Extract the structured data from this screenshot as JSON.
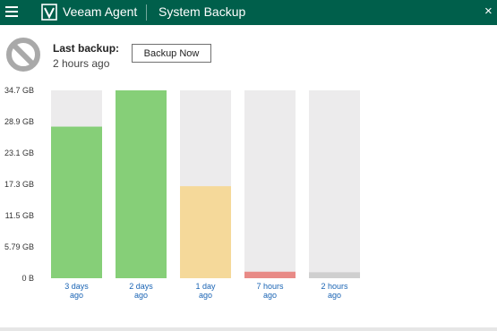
{
  "titlebar": {
    "app_name": "Veeam Agent",
    "section": "System Backup",
    "close_glyph": "×",
    "background": "#005f4b"
  },
  "status": {
    "icon": "prohibited-icon",
    "last_backup_label": "Last backup:",
    "last_backup_value": "2 hours ago"
  },
  "actions": {
    "backup_now_label": "Backup Now"
  },
  "chart_data": {
    "type": "bar",
    "y_ticks": [
      "0 B",
      "5.79 GB",
      "11.5 GB",
      "17.3 GB",
      "23.1 GB",
      "28.9 GB",
      "34.7 GB"
    ],
    "ylim": [
      0,
      34.7
    ],
    "y_unit": "GB",
    "bar_max": 34.7,
    "bars": [
      {
        "label_line1": "3 days",
        "label_line2": "ago",
        "value": 28.0,
        "color": "#86cf78"
      },
      {
        "label_line1": "2 days",
        "label_line2": "ago",
        "value": 34.7,
        "color": "#86cf78"
      },
      {
        "label_line1": "1 day",
        "label_line2": "ago",
        "value": 17.0,
        "color": "#f5d99a"
      },
      {
        "label_line1": "7 hours",
        "label_line2": "ago",
        "value": 1.2,
        "color": "#e88a86"
      },
      {
        "label_line1": "2 hours",
        "label_line2": "ago",
        "value": 1.1,
        "color": "#cfcfcf"
      }
    ],
    "background_bar_color": "#ecebec",
    "label_color": "#1a64b4",
    "grid": false
  }
}
